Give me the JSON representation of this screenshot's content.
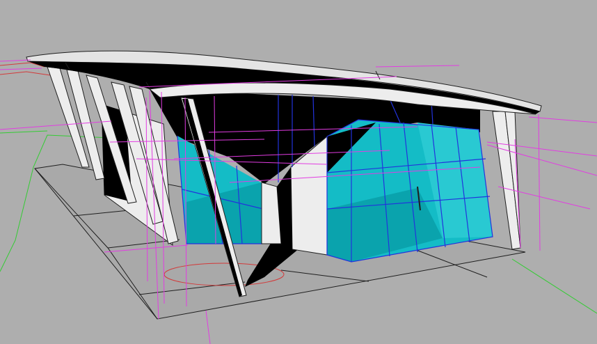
{
  "viewport": {
    "colors": {
      "background": "#aeaeae",
      "ground": "#a9a9a9",
      "edge": "#1e1e1e",
      "glass": "#14bcc6",
      "glass_dark": "#0aa3ad",
      "glass_light": "#29c9d2",
      "mullion": "#2233dd",
      "shadow": "#000000",
      "wall": "#ededed",
      "roof": "#e4e4e4",
      "guide_magenta": "#e23ce2",
      "guide_green": "#33cc33",
      "guide_red": "#d23a3a"
    }
  }
}
